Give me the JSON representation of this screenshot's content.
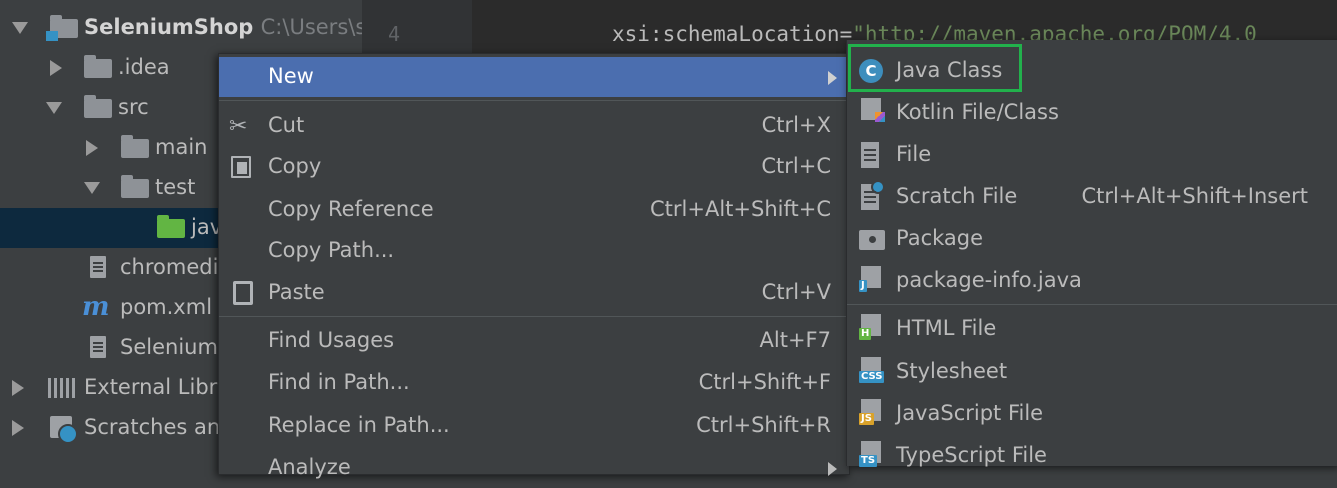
{
  "tree": {
    "rows": [
      {
        "label": "SeleniumShop",
        "path": "C:\\Users\\s"
      },
      {
        "label": ".idea"
      },
      {
        "label": "src"
      },
      {
        "label": "main"
      },
      {
        "label": "test"
      },
      {
        "label": "jav"
      },
      {
        "label": "chromedi"
      },
      {
        "label": "pom.xml"
      },
      {
        "label": "Selenium"
      },
      {
        "label": "External Libra"
      },
      {
        "label": "Scratches an"
      }
    ]
  },
  "editor": {
    "line_number": "4",
    "code_attr": "xsi:schemaLocation=",
    "code_value": "\"http://maven.apache.org/POM/4.0"
  },
  "context_menu": {
    "items": [
      {
        "label": "New",
        "shortcut": ""
      },
      {
        "label": "Cut",
        "shortcut": "Ctrl+X"
      },
      {
        "label": "Copy",
        "shortcut": "Ctrl+C"
      },
      {
        "label": "Copy Reference",
        "shortcut": "Ctrl+Alt+Shift+C"
      },
      {
        "label": "Copy Path...",
        "shortcut": ""
      },
      {
        "label": "Paste",
        "shortcut": "Ctrl+V"
      },
      {
        "label": "Find Usages",
        "shortcut": "Alt+F7"
      },
      {
        "label": "Find in Path...",
        "shortcut": "Ctrl+Shift+F"
      },
      {
        "label": "Replace in Path...",
        "shortcut": "Ctrl+Shift+R"
      },
      {
        "label": "Analyze",
        "shortcut": ""
      }
    ]
  },
  "submenu": {
    "items": [
      {
        "label": "Java Class",
        "shortcut": "",
        "icon": "java-class-icon"
      },
      {
        "label": "Kotlin File/Class",
        "shortcut": "",
        "icon": "kotlin-file-icon"
      },
      {
        "label": "File",
        "shortcut": "",
        "icon": "file-icon"
      },
      {
        "label": "Scratch File",
        "shortcut": "Ctrl+Alt+Shift+Insert",
        "icon": "scratch-file-icon"
      },
      {
        "label": "Package",
        "shortcut": "",
        "icon": "package-icon"
      },
      {
        "label": "package-info.java",
        "shortcut": "",
        "icon": "package-info-icon"
      },
      {
        "label": "HTML File",
        "shortcut": "",
        "icon": "html-file-icon"
      },
      {
        "label": "Stylesheet",
        "shortcut": "",
        "icon": "stylesheet-icon"
      },
      {
        "label": "JavaScript File",
        "shortcut": "",
        "icon": "javascript-file-icon"
      },
      {
        "label": "TypeScript File",
        "shortcut": "",
        "icon": "typescript-file-icon"
      }
    ]
  },
  "colors": {
    "menu_highlight": "#4b6eaf",
    "callout_border": "#22b14c",
    "tree_selection": "#0d293e"
  }
}
